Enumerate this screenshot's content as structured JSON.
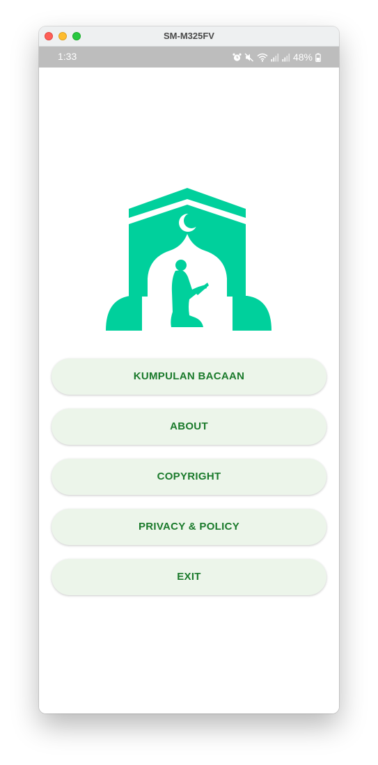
{
  "window": {
    "title": "SM-M325FV"
  },
  "status_bar": {
    "time": "1:33",
    "battery": "48%",
    "icons": [
      "alarm-icon",
      "mute-icon",
      "wifi-icon",
      "signal-icon",
      "signal-icon-2",
      "battery-icon"
    ]
  },
  "app": {
    "logo": "mosque-prayer-logo",
    "accent_color": "#00d09c",
    "button_color": "#ecf5ea",
    "button_text_color": "#1a7a2b"
  },
  "menu": {
    "items": [
      {
        "label": "KUMPULAN BACAAN"
      },
      {
        "label": "ABOUT"
      },
      {
        "label": "COPYRIGHT"
      },
      {
        "label": "PRIVACY & POLICY"
      },
      {
        "label": "EXIT"
      }
    ]
  }
}
